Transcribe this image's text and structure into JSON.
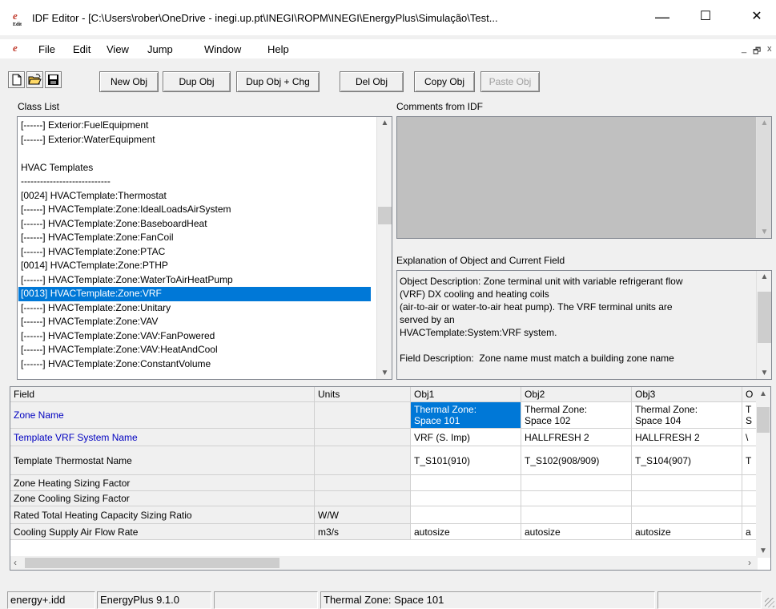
{
  "window": {
    "title": "IDF Editor - [C:\\Users\\rober\\OneDrive - inegi.up.pt\\INEGI\\ROPM\\INEGI\\EnergyPlus\\Simulação\\Test...",
    "icon": "idf-editor-app-icon",
    "minimize": "—",
    "maximize": "☐",
    "close": "✕"
  },
  "menu": {
    "items": [
      "File",
      "Edit",
      "View",
      "Jump",
      "Window",
      "Help"
    ],
    "mdi_minimize": "_",
    "mdi_restore": "🗗",
    "mdi_close": "x"
  },
  "toolbar": {
    "new_file_icon": "new-file-icon",
    "open_icon": "open-folder-icon",
    "save_icon": "save-disk-icon",
    "new_obj": "New Obj",
    "dup_obj": "Dup Obj",
    "dup_obj_chg": "Dup Obj + Chg",
    "del_obj": "Del Obj",
    "copy_obj": "Copy Obj",
    "paste_obj": "Paste Obj"
  },
  "class_list": {
    "label": "Class List",
    "items": [
      "[------]  Exterior:FuelEquipment",
      "[------]  Exterior:WaterEquipment",
      "",
      "HVAC Templates",
      "----------------------------",
      "[0024]  HVACTemplate:Thermostat",
      "[------]  HVACTemplate:Zone:IdealLoadsAirSystem",
      "[------]  HVACTemplate:Zone:BaseboardHeat",
      "[------]  HVACTemplate:Zone:FanCoil",
      "[------]  HVACTemplate:Zone:PTAC",
      "[0014]  HVACTemplate:Zone:PTHP",
      "[------]  HVACTemplate:Zone:WaterToAirHeatPump",
      "[0013]  HVACTemplate:Zone:VRF",
      "[------]  HVACTemplate:Zone:Unitary",
      "[------]  HVACTemplate:Zone:VAV",
      "[------]  HVACTemplate:Zone:VAV:FanPowered",
      "[------]  HVACTemplate:Zone:VAV:HeatAndCool",
      "[------]  HVACTemplate:Zone:ConstantVolume"
    ],
    "selected_index": 12
  },
  "comments": {
    "label": "Comments from IDF"
  },
  "explanation": {
    "label": "Explanation of Object and Current Field",
    "text": "Object Description: Zone terminal unit with variable refrigerant flow\n(VRF) DX cooling and heating coils\n(air-to-air or water-to-air heat pump). The VRF terminal units are\nserved by an\nHVACTemplate:System:VRF system.\n\nField Description:  Zone name must match a building zone name"
  },
  "grid": {
    "headers": {
      "field": "Field",
      "units": "Units",
      "objs": [
        "Obj1",
        "Obj2",
        "Obj3",
        "O"
      ]
    },
    "rows": [
      {
        "field": "Zone Name",
        "required": true,
        "units": "",
        "values": [
          [
            "Thermal Zone:",
            "Space 101"
          ],
          [
            "Thermal Zone:",
            "Space 102"
          ],
          [
            "Thermal Zone:",
            "Space 104"
          ],
          [
            "T",
            "S"
          ]
        ]
      },
      {
        "field": "Template VRF System Name",
        "required": true,
        "units": "",
        "values": [
          "VRF (S. Imp)",
          "HALLFRESH 2",
          "HALLFRESH 2",
          "\\"
        ]
      },
      {
        "field": "Template Thermostat Name",
        "required": false,
        "units": "",
        "values": [
          "T_S101(910)",
          "T_S102(908/909)",
          "T_S104(907)",
          "T"
        ]
      },
      {
        "field": "Zone Heating Sizing Factor",
        "required": false,
        "units": "",
        "values": [
          "",
          "",
          "",
          ""
        ]
      },
      {
        "field": "Zone Cooling Sizing Factor",
        "required": false,
        "units": "",
        "values": [
          "",
          "",
          "",
          ""
        ]
      },
      {
        "field": "Rated Total Heating Capacity Sizing Ratio",
        "required": false,
        "units": "W/W",
        "values": [
          "",
          "",
          "",
          ""
        ]
      },
      {
        "field": "Cooling Supply Air Flow Rate",
        "required": false,
        "units": "m3/s",
        "values": [
          "autosize",
          "autosize",
          "autosize",
          "a"
        ]
      }
    ],
    "selected_cell": "0-0"
  },
  "status": {
    "idd": "energy+.idd",
    "version": "EnergyPlus 9.1.0",
    "current": "Thermal Zone: Space 101"
  },
  "colors": {
    "selection": "#0078d7",
    "required_field": "#0000c0",
    "app_icon": "#c0392b"
  }
}
